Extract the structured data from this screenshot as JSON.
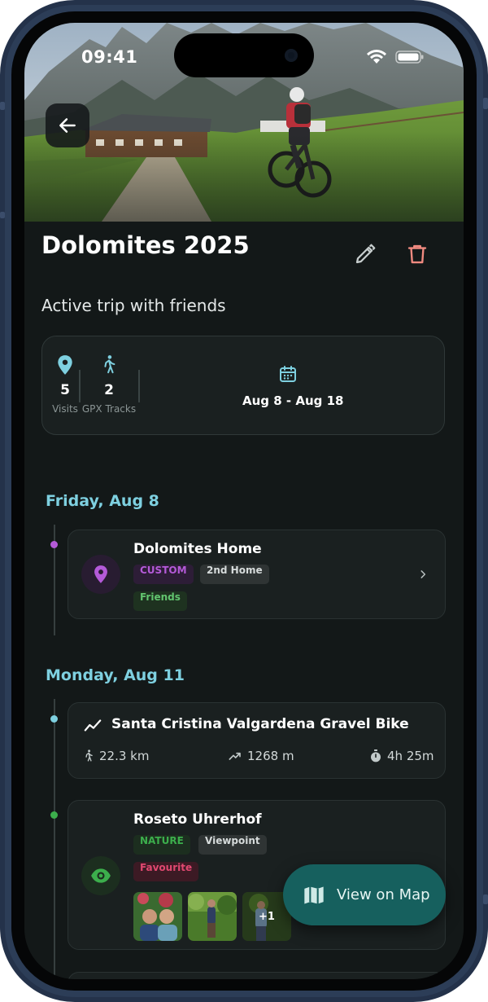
{
  "status_bar": {
    "time": "09:41"
  },
  "trip": {
    "title": "Dolomites 2025",
    "description": "Active trip with friends",
    "stats": {
      "visits_count": "5",
      "visits_label": "Visits",
      "tracks_count": "2",
      "tracks_label": "GPX Tracks",
      "date_range": "Aug 8 - Aug 18"
    }
  },
  "timeline": [
    {
      "day": "Friday, Aug 8",
      "entries": [
        {
          "type": "visit",
          "title": "Dolomites Home",
          "icon": "location-pin-icon",
          "tags": [
            "CUSTOM",
            "2nd Home",
            "Friends"
          ]
        }
      ]
    },
    {
      "day": "Monday, Aug 11",
      "entries": [
        {
          "type": "track",
          "title": "Santa Cristina Valgardena Gravel Bike",
          "icon": "trending-line-icon",
          "distance": "22.3 km",
          "elevation": "1268 m",
          "duration": "4h 25m"
        },
        {
          "type": "visit",
          "title": "Roseto Uhrerhof",
          "icon": "eye-icon",
          "tags": [
            "NATURE",
            "Viewpoint",
            "Favourite"
          ],
          "photos_extra": "+1"
        }
      ]
    }
  ],
  "fab": {
    "label": "View on Map",
    "icon": "map-icon"
  },
  "colors": {
    "background": "#131818",
    "accent": "#7ed0e0",
    "fab": "#16605e",
    "delete": "#f08a80",
    "custom_tag": "#b45ad8",
    "nature_tag": "#3cae4c",
    "favourite_tag": "#e04870"
  }
}
